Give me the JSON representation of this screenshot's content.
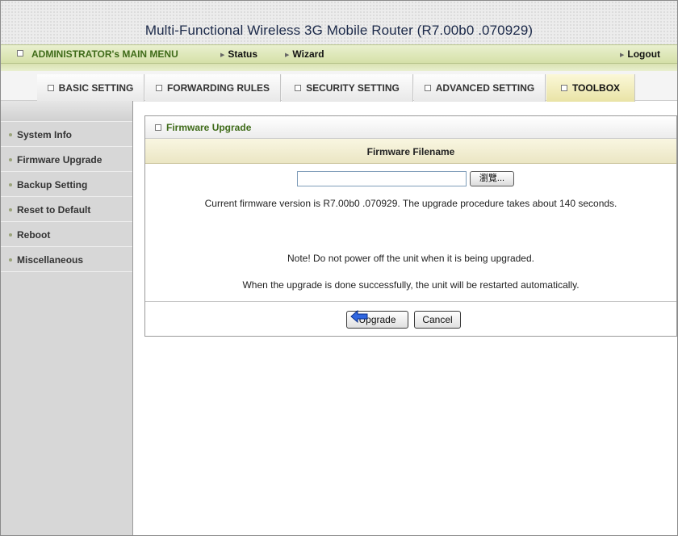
{
  "window": {
    "title": "Multi-Functional Wireless 3G Mobile Router (R7.00b0 .070929)"
  },
  "menu": {
    "admin_label": "ADMINISTRATOR's MAIN MENU",
    "status_label": "Status",
    "wizard_label": "Wizard",
    "logout_label": "Logout"
  },
  "tabs": [
    {
      "label": "BASIC SETTING",
      "active": false
    },
    {
      "label": "FORWARDING RULES",
      "active": false
    },
    {
      "label": "SECURITY SETTING",
      "active": false
    },
    {
      "label": "ADVANCED SETTING",
      "active": false
    },
    {
      "label": "TOOLBOX",
      "active": true
    }
  ],
  "sidebar": {
    "items": [
      {
        "label": "System Info"
      },
      {
        "label": "Firmware Upgrade"
      },
      {
        "label": "Backup Setting"
      },
      {
        "label": "Reset to Default"
      },
      {
        "label": "Reboot"
      },
      {
        "label": "Miscellaneous"
      }
    ]
  },
  "panel": {
    "title": "Firmware Upgrade",
    "column_header": "Firmware Filename",
    "file_value": "",
    "browse_label": "瀏覽...",
    "current_version_text": "Current firmware version is R7.00b0 .070929. The upgrade procedure takes about 140 seconds.",
    "note_text": "Note! Do not power off the unit when it is being upgraded.",
    "restart_text": "When the upgrade is done successfully, the unit will be restarted automatically.",
    "upgrade_label": "Upgrade",
    "cancel_label": "Cancel"
  },
  "colors": {
    "menu_green": "#3f6b19",
    "active_tab": "#e9e3a6",
    "sidebar_bg": "#d7d7d7",
    "cursor_blue": "#2f66e0"
  },
  "icons": {
    "cursor": "pointer-arrow-icon"
  }
}
